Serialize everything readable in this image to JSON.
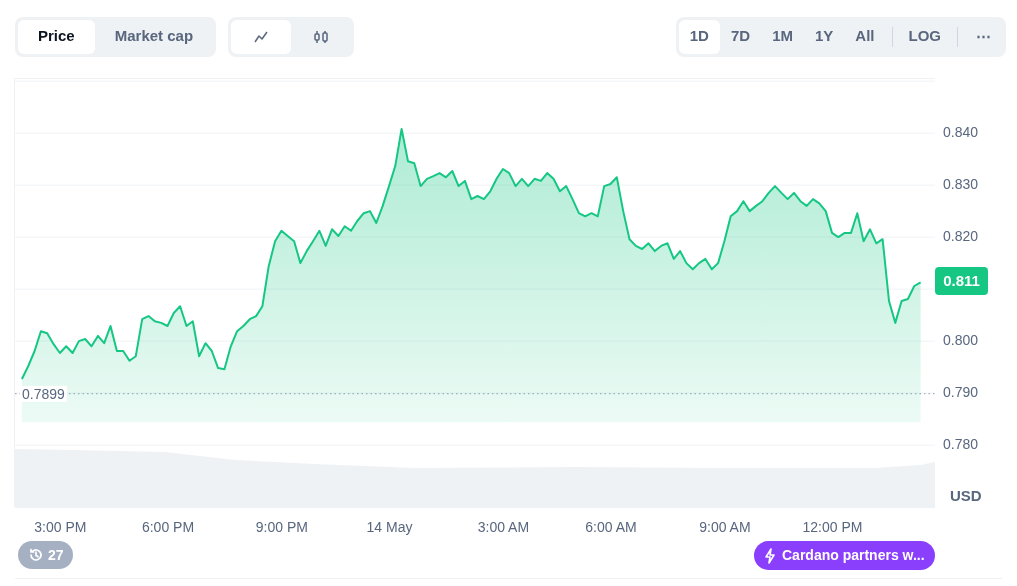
{
  "tabs": [
    {
      "label": "Price",
      "selected": true
    },
    {
      "label": "Market cap",
      "selected": false
    }
  ],
  "chart_types": [
    {
      "kind": "line",
      "selected": true
    },
    {
      "kind": "candlestick",
      "selected": false
    }
  ],
  "ranges": [
    {
      "label": "1D",
      "selected": true
    },
    {
      "label": "7D",
      "selected": false
    },
    {
      "label": "1M",
      "selected": false
    },
    {
      "label": "1Y",
      "selected": false
    },
    {
      "label": "All",
      "selected": false
    }
  ],
  "scale_button": {
    "label": "LOG",
    "selected": false
  },
  "more_button": "⋯",
  "chart": {
    "currency": "USD",
    "chart_data": {
      "type": "area",
      "categories": [
        null,
        null,
        null,
        null,
        null,
        null,
        null,
        "3:00 PM",
        null,
        null,
        null,
        null,
        null,
        null,
        null,
        null,
        null,
        null,
        null,
        null,
        null,
        null,
        null,
        null,
        "6:00 PM",
        null,
        null,
        null,
        null,
        null,
        null,
        null,
        null,
        null,
        null,
        null,
        null,
        null,
        null,
        null,
        null,
        null,
        "9:00 PM",
        null,
        null,
        null,
        null,
        null,
        null,
        null,
        null,
        null,
        null,
        null,
        null,
        null,
        null,
        null,
        null,
        "14 May",
        null,
        null,
        null,
        null,
        null,
        null,
        null,
        null,
        null,
        null,
        null,
        null,
        null,
        null,
        null,
        null,
        null,
        "3:00 AM",
        null,
        null,
        null,
        null,
        null,
        null,
        null,
        null,
        null,
        null,
        null,
        null,
        null,
        null,
        null,
        null,
        "6:00 AM",
        null,
        null,
        null,
        null,
        null,
        null,
        null,
        null,
        null,
        null,
        null,
        null,
        null,
        null,
        null,
        null,
        null,
        "9:00 AM",
        null,
        null,
        null,
        null,
        null,
        null,
        null,
        null,
        null,
        null,
        null,
        null,
        null,
        null,
        null,
        null,
        "12:00 PM",
        null,
        null,
        null,
        null,
        null,
        null,
        null,
        null,
        null,
        null,
        null,
        null,
        null,
        null
      ],
      "series": [
        {
          "color": "#16c784",
          "values": [
            null,
            0.7927,
            0.7952,
            0.7981,
            0.8019,
            0.8015,
            0.7994,
            0.7977,
            0.799,
            0.7977,
            0.8,
            0.8004,
            0.799,
            0.801,
            0.7996,
            0.8029,
            0.7981,
            0.7981,
            0.7962,
            0.7971,
            0.8042,
            0.8048,
            0.8038,
            0.8035,
            0.8029,
            0.8054,
            0.8067,
            0.8029,
            0.8038,
            0.7971,
            0.7996,
            0.7981,
            0.7948,
            0.7946,
            0.799,
            0.8019,
            0.8029,
            0.8042,
            0.8048,
            0.8067,
            0.8144,
            0.8192,
            0.8212,
            0.8202,
            0.8192,
            0.815,
            0.8173,
            0.8192,
            0.8212,
            0.8183,
            0.8215,
            0.8202,
            0.8221,
            0.8212,
            0.8231,
            0.8246,
            0.825,
            0.8227,
            0.826,
            0.8298,
            0.8337,
            0.8408,
            0.8346,
            0.8342,
            0.8298,
            0.8312,
            0.8317,
            0.8323,
            0.8315,
            0.8327,
            0.8298,
            0.8308,
            0.8273,
            0.8279,
            0.8273,
            0.8288,
            0.8312,
            0.8331,
            0.8323,
            0.8298,
            0.8312,
            0.8298,
            0.8312,
            0.8308,
            0.8323,
            0.8312,
            0.8288,
            0.8298,
            0.8273,
            0.8246,
            0.824,
            0.8246,
            0.824,
            0.8298,
            0.8302,
            0.8315,
            0.825,
            0.8196,
            0.8183,
            0.8177,
            0.8188,
            0.8173,
            0.8183,
            0.8188,
            0.8158,
            0.8173,
            0.815,
            0.8138,
            0.815,
            0.8158,
            0.8138,
            0.815,
            0.8192,
            0.824,
            0.825,
            0.8269,
            0.825,
            0.826,
            0.8269,
            0.8285,
            0.8298,
            0.8285,
            0.8273,
            0.8285,
            0.8269,
            0.826,
            0.8273,
            0.8265,
            0.825,
            0.8208,
            0.82,
            0.8208,
            0.8208,
            0.8246,
            0.8192,
            0.8215,
            0.8188,
            0.8196,
            0.8077,
            0.8035,
            0.8077,
            0.8081,
            0.8106,
            0.8113
          ]
        }
      ],
      "grid": true,
      "ylim": [
        0.7679,
        0.8504
      ],
      "yticks": [
        {
          "value": 0.84,
          "label": "0.840"
        },
        {
          "value": 0.83,
          "label": "0.830"
        },
        {
          "value": 0.82,
          "label": "0.820"
        },
        {
          "value": 0.8,
          "label": "0.800"
        },
        {
          "value": 0.79,
          "label": "0.790"
        },
        {
          "value": 0.78,
          "label": "0.780"
        }
      ],
      "ref_lines": [
        {
          "axis": "y",
          "value": 0.7899,
          "label": "0.7899"
        }
      ]
    },
    "price_tag": "0.811"
  },
  "history_badge": {
    "count": "27"
  },
  "news_pill": {
    "text": "Cardano partners w..."
  }
}
